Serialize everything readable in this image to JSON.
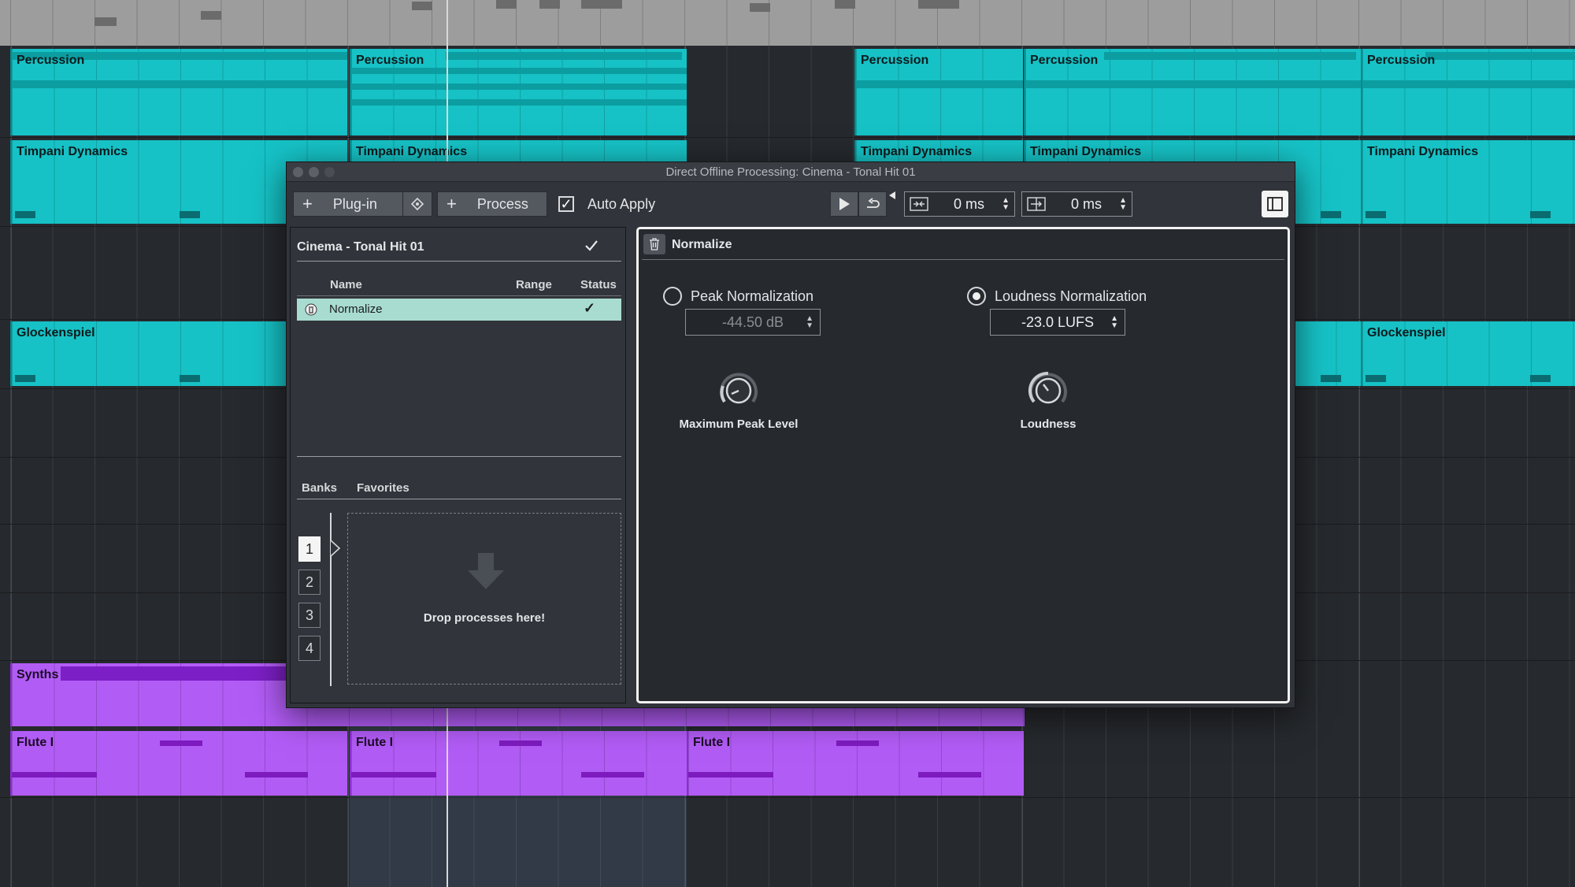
{
  "window": {
    "title": "Direct Offline Processing: Cinema - Tonal Hit 01"
  },
  "toolbar": {
    "plugin_plus": "+",
    "plugin_label": "Plug-in",
    "process_plus": "+",
    "process_label": "Process",
    "auto_apply_label": "Auto Apply",
    "auto_apply_checked": true,
    "pre_crossfade_value": "0 ms",
    "post_crossfade_value": "0 ms"
  },
  "process_list": {
    "clip_name": "Cinema - Tonal Hit 01",
    "columns": [
      "Name",
      "Range",
      "Status"
    ],
    "rows": [
      {
        "name": "Normalize",
        "range": "",
        "status": "✓"
      }
    ]
  },
  "banks": {
    "tabs": [
      "Banks",
      "Favorites"
    ],
    "numbers": [
      "1",
      "2",
      "3",
      "4"
    ],
    "selected": "1",
    "drop_text": "Drop processes here!"
  },
  "normalize": {
    "title": "Normalize",
    "peak_label": "Peak Normalization",
    "peak_value": "-44.50 dB",
    "loudness_label": "Loudness Normalization",
    "loudness_value": "-23.0 LUFS",
    "selected_mode": "loudness",
    "knob1_label": "Maximum Peak Level",
    "knob2_label": "Loudness"
  },
  "tracks": {
    "percussion": "Percussion",
    "timpani": "Timpani Dynamics",
    "glockenspiel": "Glockenspiel",
    "synths": "Synths",
    "flute": "Flute I"
  },
  "colors": {
    "track_teal": "#16c2c6",
    "track_purple": "#b25cf6",
    "panel_bg": "#262a2f",
    "selection": "#a9dcd0"
  }
}
